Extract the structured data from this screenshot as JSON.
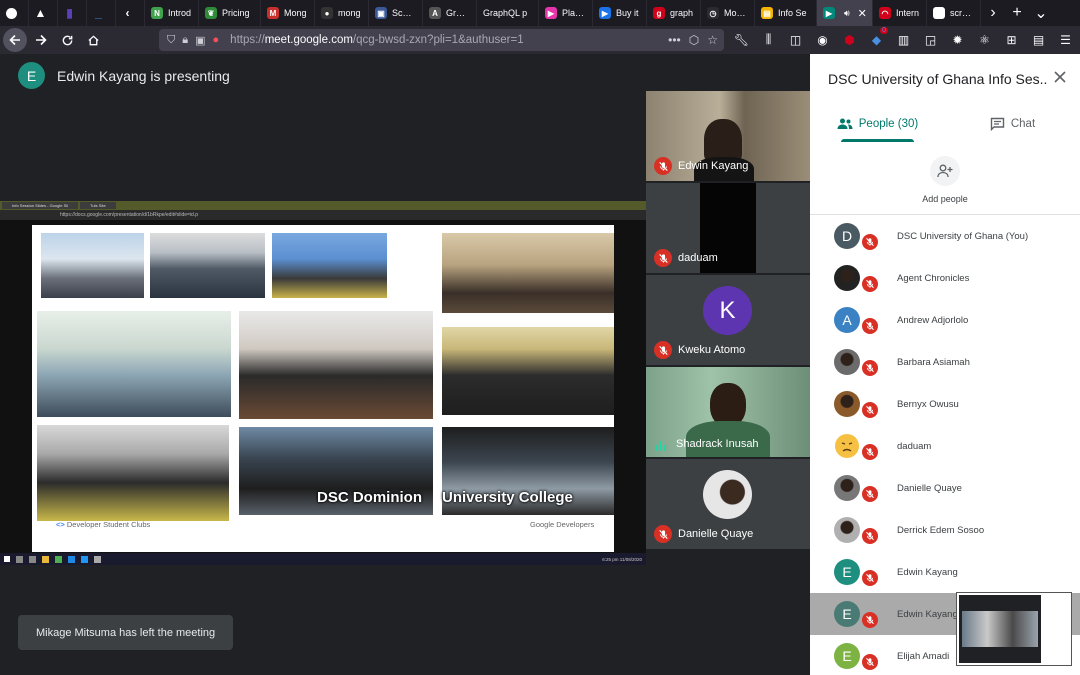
{
  "browser": {
    "tabs": [
      {
        "label": "",
        "icon": "github-icon",
        "color": "#ffffff",
        "pinned": true
      },
      {
        "label": "",
        "icon": "warning-icon",
        "color": "#ffffff",
        "pinned": true
      },
      {
        "label": "",
        "icon": "bootstrap-icon",
        "color": "#5b3fb8",
        "pinned": true
      },
      {
        "label": "",
        "icon": "underline-icon",
        "color": "#4a90e2",
        "pinned": true
      },
      {
        "label": "",
        "icon": "chevron-left-icon",
        "color": "#ffffff",
        "pinned": true
      },
      {
        "label": "Introd",
        "icon": "n-icon",
        "color": "#3fa34d"
      },
      {
        "label": "Pricing",
        "icon": "leaf-icon",
        "color": "#2e8b3a"
      },
      {
        "label": "Mong",
        "icon": "m-icon",
        "color": "#c9302c"
      },
      {
        "label": "mong",
        "icon": "github-icon",
        "color": "#333333"
      },
      {
        "label": "Schoo",
        "icon": "school-icon",
        "color": "#3b5998"
      },
      {
        "label": "Graph",
        "icon": "apollo-icon",
        "color": "#555555"
      },
      {
        "label": "GraphQL p",
        "icon": "",
        "color": ""
      },
      {
        "label": "Playgr",
        "icon": "playground-icon",
        "color": "#e535ab"
      },
      {
        "label": "Buy it",
        "icon": "meet-icon",
        "color": "#1a73e8"
      },
      {
        "label": "graph",
        "icon": "g-icon",
        "color": "#d0021b"
      },
      {
        "label": "Mome",
        "icon": "clock-icon",
        "color": "#2b2a33"
      },
      {
        "label": "Info Se",
        "icon": "doc-icon",
        "color": "#f4b400"
      },
      {
        "label": "",
        "icon": "meet-icon",
        "color": "#00897b",
        "active": true
      },
      {
        "label": "Intern",
        "icon": "speed-icon",
        "color": "#d0021b"
      },
      {
        "label": "screen",
        "icon": "google-icon",
        "color": "#ffffff"
      }
    ],
    "url_prefix": "https://",
    "url_domain": "meet.google.com",
    "url_rest": "/qcg-bwsd-zxn?pli=1&authuser=1",
    "badge_count": "0"
  },
  "meet": {
    "presenter_initial": "E",
    "presenter_text": "Edwin Kayang is presenting",
    "toast": "Mikage Mitsuma has left the meeting",
    "slide": {
      "caption_left": "DSC Dominion",
      "caption_right": "University College",
      "footer_left": "Developer Student Clubs",
      "footer_right": "Google Developers",
      "browser_tab1": "Info Session Slides - Google Sli",
      "browser_tab2": "Tuts Site",
      "address": "https://docs.google.com/presentation/d/1bRkpe/edit#slide=id.p",
      "clock": "6:25 pm 11/08/2020"
    },
    "tiles": [
      {
        "name": "Edwin Kayang",
        "status": "muted",
        "kind": "video"
      },
      {
        "name": "daduam",
        "status": "muted",
        "kind": "dark"
      },
      {
        "name": "Kweku Atomo",
        "status": "muted",
        "kind": "avatar",
        "initial": "K",
        "color": "#5e35b1"
      },
      {
        "name": "Shadrack Inusah",
        "status": "speaking",
        "kind": "video"
      },
      {
        "name": "Danielle Quaye",
        "status": "muted",
        "kind": "photo"
      }
    ]
  },
  "panel": {
    "title": "DSC University of Ghana Info Ses...",
    "tab_people": "People (30)",
    "tab_chat": "Chat",
    "add_people": "Add people",
    "participants": [
      {
        "name": "DSC University of Ghana (You)",
        "initial": "D",
        "color": "#4a5a63",
        "kind": "letter"
      },
      {
        "name": "Agent Chronicles",
        "initial": "",
        "color": "#222222",
        "kind": "photo"
      },
      {
        "name": "Andrew Adjorlolo",
        "initial": "A",
        "color": "#3b82c4",
        "kind": "letter"
      },
      {
        "name": "Barbara Asiamah",
        "initial": "",
        "color": "#6b6b6b",
        "kind": "photo"
      },
      {
        "name": "Bernyx Owusu",
        "initial": "",
        "color": "#8a5a2a",
        "kind": "photo"
      },
      {
        "name": "daduam",
        "initial": "",
        "color": "#f6c142",
        "kind": "emoji"
      },
      {
        "name": "Danielle Quaye",
        "initial": "",
        "color": "#777777",
        "kind": "photo"
      },
      {
        "name": "Derrick Edem Sosoo",
        "initial": "",
        "color": "#b0b0b0",
        "kind": "photo"
      },
      {
        "name": "Edwin Kayang",
        "initial": "E",
        "color": "#1e8e7e",
        "kind": "letter"
      },
      {
        "name": "Edwin Kayang",
        "initial": "E",
        "color": "#4a7a74",
        "kind": "letter",
        "highlighted": true
      },
      {
        "name": "Elijah Amadi",
        "initial": "E",
        "color": "#7cb342",
        "kind": "letter"
      }
    ]
  }
}
